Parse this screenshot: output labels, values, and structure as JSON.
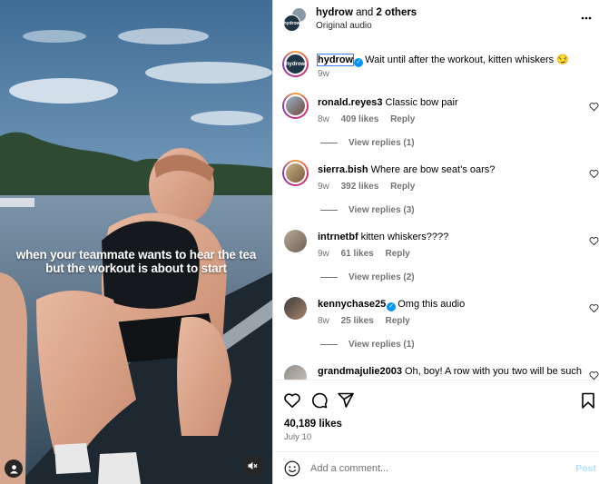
{
  "video": {
    "caption_line1": "when your teammate wants to hear the tea",
    "caption_line2": "but the workout is about to start",
    "user_tag_icon": "person-icon",
    "mute_icon": "speaker-muted-icon"
  },
  "header": {
    "owner": "hydrow",
    "connector": " and ",
    "others": "2 others",
    "audio": "Original audio",
    "brand_avatar_text": "hydrow",
    "more_icon": "more-horizontal-icon"
  },
  "caption_comment": {
    "username": "hydrow",
    "text": "Wait until after the workout, kitten whiskers 😏",
    "time": "9w",
    "avatar_text": "hydrow"
  },
  "comments": [
    {
      "username": "ronald.reyes3",
      "text": "Classic bow pair",
      "time": "8w",
      "likes": "409 likes",
      "reply": "Reply",
      "view_replies": "View replies (1)",
      "story_ring": true,
      "verified": false
    },
    {
      "username": "sierra.bish",
      "text": "Where are bow seat’s oars?",
      "time": "9w",
      "likes": "392 likes",
      "reply": "Reply",
      "view_replies": "View replies (3)",
      "story_ring": true,
      "verified": false
    },
    {
      "username": "intrnetbf",
      "text": "kitten whiskers????",
      "time": "9w",
      "likes": "61 likes",
      "reply": "Reply",
      "view_replies": "View replies (2)",
      "story_ring": false,
      "verified": false
    },
    {
      "username": "kennychase25",
      "text": "Omg this audio",
      "time": "8w",
      "likes": "25 likes",
      "reply": "Reply",
      "view_replies": "View replies (1)",
      "story_ring": false,
      "verified": true
    },
    {
      "username": "grandmajulie2003",
      "text": "Oh, boy! A row with you two will be such",
      "time": "",
      "likes": "",
      "reply": "",
      "view_replies": "",
      "story_ring": false,
      "verified": false
    }
  ],
  "actions": {
    "like_icon": "heart-icon",
    "comment_icon": "comment-icon",
    "share_icon": "send-icon",
    "save_icon": "bookmark-icon",
    "likes_count": "40,189 likes",
    "date": "July 10"
  },
  "composer": {
    "placeholder": "Add a comment...",
    "post_label": "Post",
    "emoji_icon": "emoji-icon"
  },
  "colors": {
    "accent_blue": "#0095f6",
    "post_disabled": "#b2dffc",
    "muted_text": "#737373"
  }
}
